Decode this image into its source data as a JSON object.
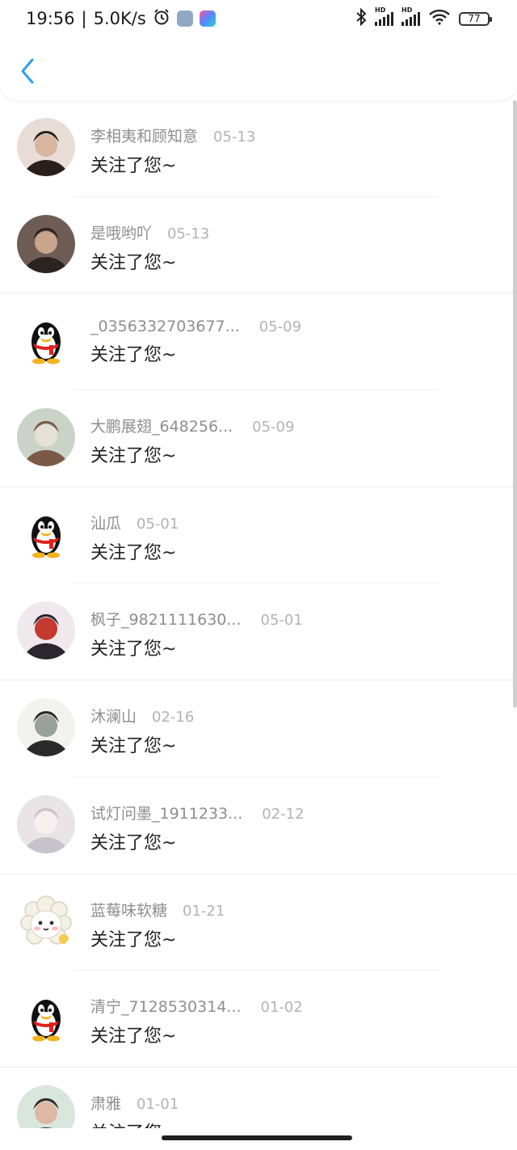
{
  "status_bar": {
    "time": "19:56",
    "speed": "5.0K/s",
    "battery": "77",
    "network_label": "HD"
  },
  "header": {
    "back_icon": "chevron-left-icon"
  },
  "colors": {
    "accent": "#2f9ff0",
    "name": "#8e8e8e",
    "time": "#b3b3b3"
  },
  "items": [
    {
      "name": "李相夷和顾知意",
      "time": "05-13",
      "action": "关注了您~",
      "avatar": "photo"
    },
    {
      "name": "是哦哟吖",
      "time": "05-13",
      "action": "关注了您~",
      "avatar": "photo"
    },
    {
      "name": "_0356332703677...",
      "time": "05-09",
      "action": "关注了您~",
      "avatar": "qq-penguin"
    },
    {
      "name": "大鹏展翅_648256...",
      "time": "05-09",
      "action": "关注了您~",
      "avatar": "photo"
    },
    {
      "name": "汕瓜",
      "time": "05-01",
      "action": "关注了您~",
      "avatar": "qq-penguin"
    },
    {
      "name": "枫子_9821111630...",
      "time": "05-01",
      "action": "关注了您~",
      "avatar": "photo"
    },
    {
      "name": "沐澜山",
      "time": "02-16",
      "action": "关注了您~",
      "avatar": "photo"
    },
    {
      "name": "试灯问墨_1911233...",
      "time": "02-12",
      "action": "关注了您~",
      "avatar": "photo"
    },
    {
      "name": "蓝莓味软糖",
      "time": "01-21",
      "action": "关注了您~",
      "avatar": "sheep"
    },
    {
      "name": "清宁_7128530314...",
      "time": "01-02",
      "action": "关注了您~",
      "avatar": "qq-penguin"
    },
    {
      "name": "肃雅",
      "time": "01-01",
      "action": "关注了您~",
      "avatar": "photo"
    }
  ]
}
